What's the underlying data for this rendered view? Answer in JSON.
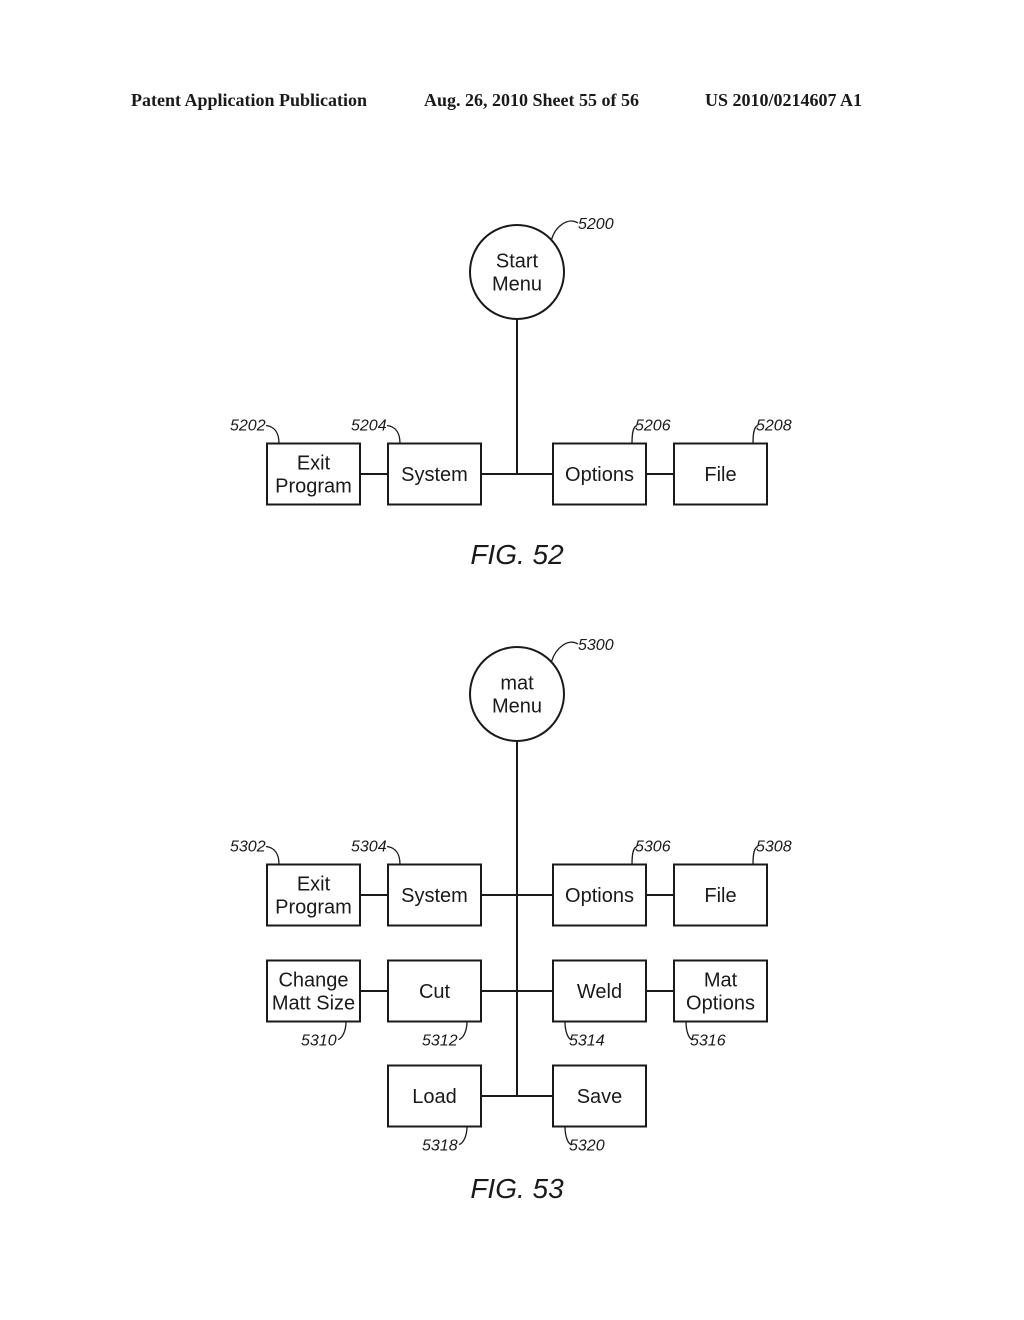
{
  "header": {
    "left": "Patent Application Publication",
    "middle": "Aug. 26, 2010  Sheet 55 of 56",
    "right": "US 2010/0214607 A1"
  },
  "figures": [
    {
      "caption": "FIG. 52",
      "root": {
        "ref": "5200",
        "lines": [
          "Start",
          "Menu"
        ]
      },
      "nodes": [
        {
          "id": "exit-program",
          "ref": "5202",
          "lines": [
            "Exit",
            "Program"
          ]
        },
        {
          "id": "system",
          "ref": "5204",
          "lines": [
            "System"
          ]
        },
        {
          "id": "options",
          "ref": "5206",
          "lines": [
            "Options"
          ]
        },
        {
          "id": "file",
          "ref": "5208",
          "lines": [
            "File"
          ]
        }
      ]
    },
    {
      "caption": "FIG. 53",
      "root": {
        "ref": "5300",
        "lines": [
          "mat",
          "Menu"
        ]
      },
      "nodes": [
        {
          "id": "exit-program",
          "ref": "5302",
          "lines": [
            "Exit",
            "Program"
          ]
        },
        {
          "id": "system",
          "ref": "5304",
          "lines": [
            "System"
          ]
        },
        {
          "id": "options",
          "ref": "5306",
          "lines": [
            "Options"
          ]
        },
        {
          "id": "file",
          "ref": "5308",
          "lines": [
            "File"
          ]
        },
        {
          "id": "change-matt-size",
          "ref": "5310",
          "lines": [
            "Change",
            "Matt Size"
          ]
        },
        {
          "id": "cut",
          "ref": "5312",
          "lines": [
            "Cut"
          ]
        },
        {
          "id": "weld",
          "ref": "5314",
          "lines": [
            "Weld"
          ]
        },
        {
          "id": "mat-options",
          "ref": "5316",
          "lines": [
            "Mat",
            "Options"
          ]
        },
        {
          "id": "load",
          "ref": "5318",
          "lines": [
            "Load"
          ]
        },
        {
          "id": "save",
          "ref": "5320",
          "lines": [
            "Save"
          ]
        }
      ]
    }
  ]
}
